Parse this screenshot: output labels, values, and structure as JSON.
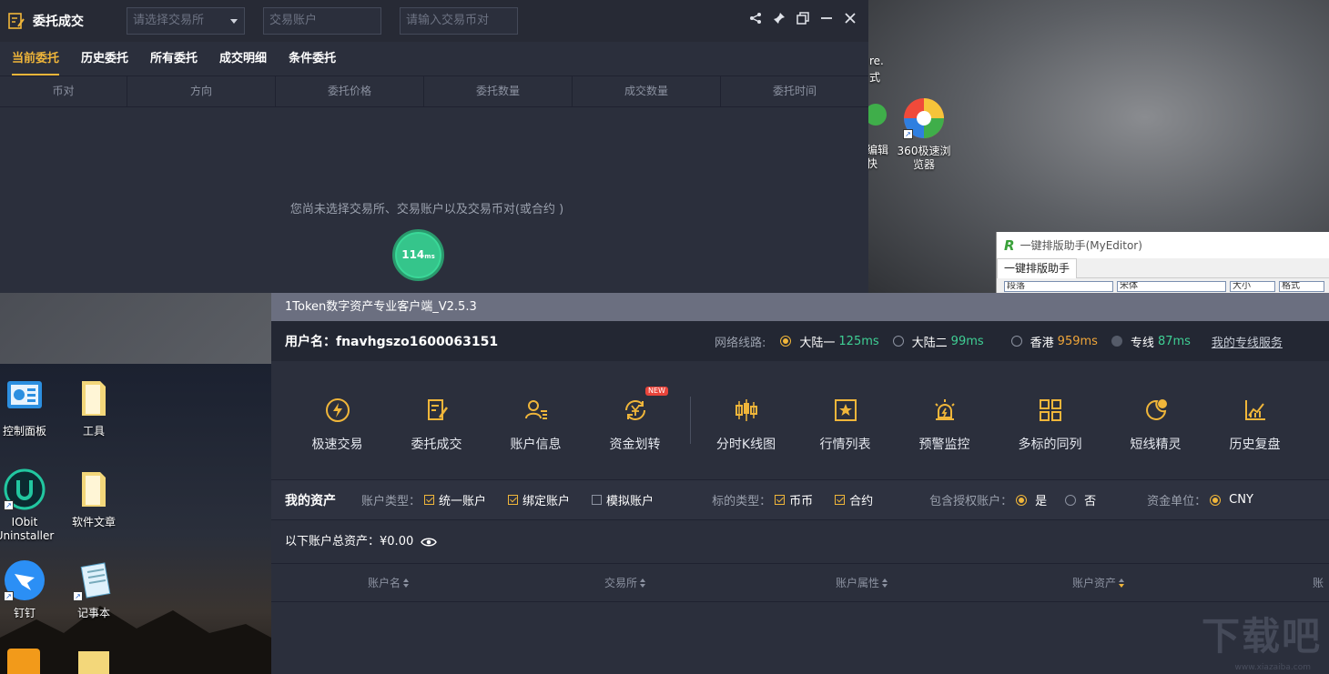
{
  "desktop": {
    "right_icons": [
      {
        "label": "360极速浏览器"
      },
      {
        "label": "编辑快"
      }
    ],
    "partial_text": [
      "re.",
      "式"
    ],
    "left_icons": [
      {
        "label": "控制面板"
      },
      {
        "label": "工具"
      },
      {
        "label": "IObit Uninstaller"
      },
      {
        "label": "软件文章"
      },
      {
        "label": "钉钉"
      },
      {
        "label": "记事本"
      }
    ]
  },
  "order_window": {
    "title": "委托成交",
    "exchange_select_placeholder": "请选择交易所",
    "account_placeholder": "交易账户",
    "coin_placeholder": "请输入交易币对",
    "tabs": [
      "当前委托",
      "历史委托",
      "所有委托",
      "成交明细",
      "条件委托"
    ],
    "active_tab": 0,
    "columns": [
      "币对",
      "方向",
      "委托价格",
      "委托数量",
      "成交数量",
      "委托时间"
    ],
    "empty_message": "您尚未选择交易所、交易账户以及交易币对(或合约 )",
    "latency_value": "114",
    "latency_unit": "ms"
  },
  "myeditor": {
    "title": "一键排版助手(MyEditor)",
    "tab": "一键排版助手",
    "ribbon": [
      "段落",
      "宋体",
      "大小",
      "格式"
    ]
  },
  "main_window": {
    "title": "1Token数字资产专业客户端_V2.5.3",
    "username_label": "用户名：",
    "username": "fnavhgszo1600063151",
    "network_label": "网络线路:",
    "routes": [
      {
        "name": "大陆一",
        "latency": "125ms",
        "color": "#3fcf94",
        "selected": true
      },
      {
        "name": "大陆二",
        "latency": "99ms",
        "color": "#3fcf94",
        "selected": false
      },
      {
        "name": "香港",
        "latency": "959ms",
        "color": "#f0a63a",
        "selected": false
      },
      {
        "name": "专线",
        "latency": "87ms",
        "color": "#3fcf94",
        "selected": false
      }
    ],
    "dedicated_link": "我的专线服务",
    "tools": [
      {
        "label": "极速交易",
        "icon": "lightning-icon"
      },
      {
        "label": "委托成交",
        "icon": "order-edit-icon"
      },
      {
        "label": "账户信息",
        "icon": "user-list-icon"
      },
      {
        "label": "资金划转",
        "icon": "yen-transfer-icon",
        "badge": "NEW"
      },
      {
        "label": "分时K线图",
        "icon": "candlestick-icon"
      },
      {
        "label": "行情列表",
        "icon": "star-list-icon"
      },
      {
        "label": "预警监控",
        "icon": "alarm-icon"
      },
      {
        "label": "多标的同列",
        "icon": "grid-icon"
      },
      {
        "label": "短线精灵",
        "icon": "moon-icon"
      },
      {
        "label": "历史复盘",
        "icon": "chart-up-icon"
      }
    ],
    "assets": {
      "heading": "我的资产",
      "account_type_label": "账户类型：",
      "account_types": [
        {
          "label": "统一账户",
          "checked": true
        },
        {
          "label": "绑定账户",
          "checked": true
        },
        {
          "label": "模拟账户",
          "checked": false
        }
      ],
      "target_type_label": "标的类型：",
      "target_types": [
        {
          "label": "币币",
          "checked": true
        },
        {
          "label": "合约",
          "checked": true
        }
      ],
      "auth_label": "包含授权账户：",
      "auth_options": [
        {
          "label": "是",
          "selected": true
        },
        {
          "label": "否",
          "selected": false
        }
      ],
      "unit_label": "资金单位：",
      "unit": "CNY",
      "total_label": "以下账户总资产：",
      "total_value": "¥0.00",
      "columns": [
        "账户名",
        "交易所",
        "账户属性",
        "账户资产",
        "账"
      ]
    },
    "watermark": "下载吧",
    "watermark_sub": "www.xiazaiba.com"
  }
}
